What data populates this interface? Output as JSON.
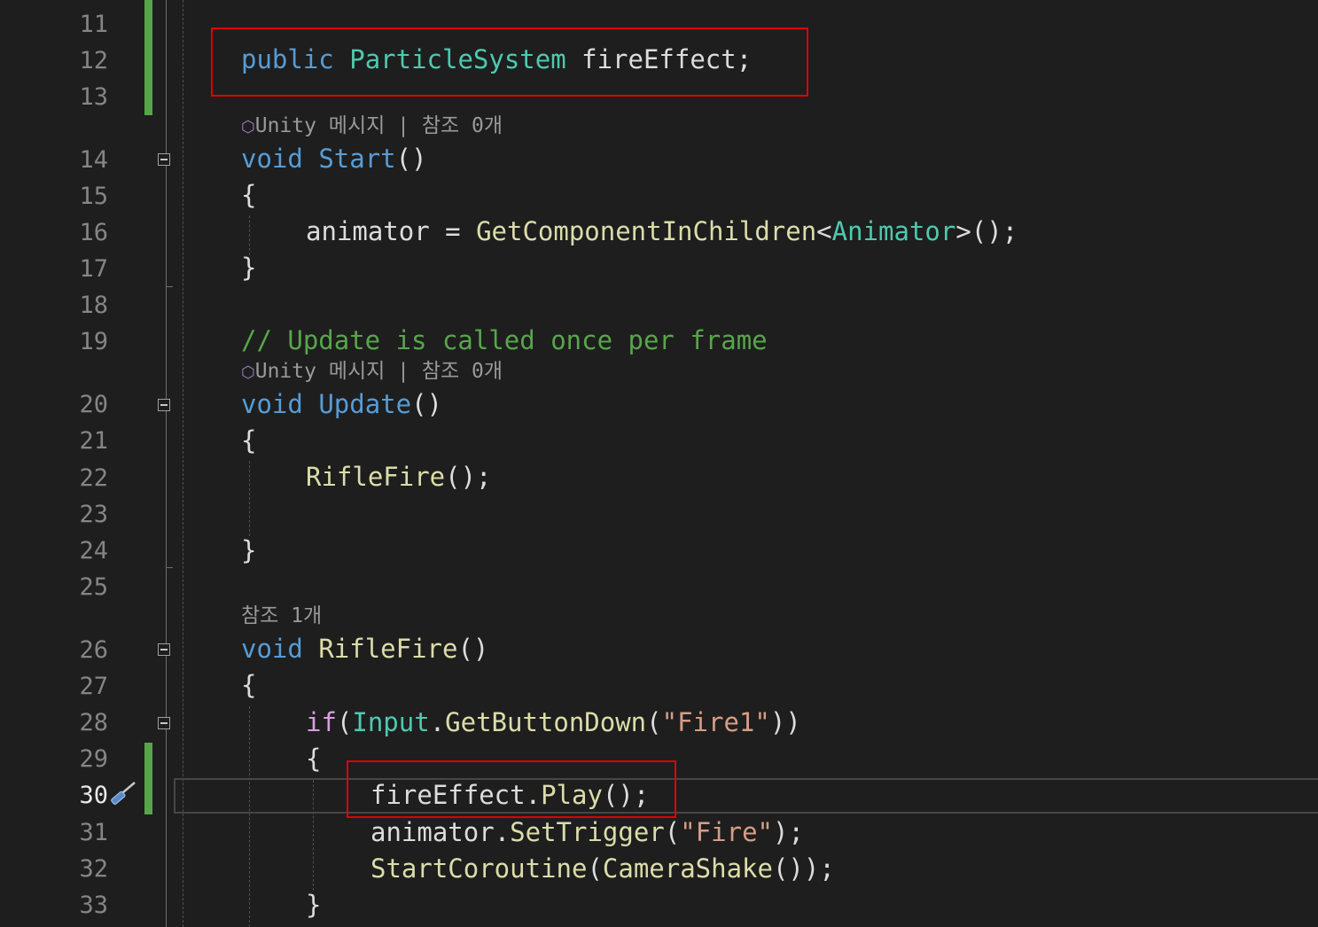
{
  "editor": {
    "line_numbers": [
      "11",
      "12",
      "13",
      "14",
      "15",
      "16",
      "17",
      "18",
      "19",
      "20",
      "21",
      "22",
      "23",
      "24",
      "25",
      "26",
      "27",
      "28",
      "29",
      "30",
      "31",
      "32",
      "33"
    ],
    "current_line": "30",
    "code": {
      "l12": {
        "kw": "public",
        "type": "ParticleSystem",
        "rest": " fireEffect;"
      },
      "l14": {
        "kw": "void",
        "name": "Start",
        "rest": "()"
      },
      "l15": "{",
      "l16": {
        "lhs": "animator = ",
        "method": "GetComponentInChildren",
        "lt": "<",
        "type": "Animator",
        "rest": ">();"
      },
      "l17": "}",
      "l19": "// Update is called once per frame",
      "l20": {
        "kw": "void",
        "name": "Update",
        "rest": "()"
      },
      "l21": "{",
      "l22": {
        "method": "RifleFire",
        "rest": "();"
      },
      "l24": "}",
      "l26": {
        "kw": "void",
        "name": "RifleFire",
        "rest": "()"
      },
      "l27": "{",
      "l28": {
        "kw": "if",
        "p1": "(",
        "type": "Input",
        "dot": ".",
        "method": "GetButtonDown",
        "p2": "(",
        "str": "\"Fire1\"",
        "p3": "))"
      },
      "l29": "{",
      "l30": {
        "obj": "fireEffect",
        "dot": ".",
        "method": "Play",
        "rest": "();"
      },
      "l31": {
        "obj": "animator",
        "dot": ".",
        "method": "SetTrigger",
        "p1": "(",
        "str": "\"Fire\"",
        "rest": ");"
      },
      "l32": {
        "method": "StartCoroutine",
        "p1": "(",
        "method2": "CameraShake",
        "rest": "());"
      },
      "l33": "}"
    },
    "codelens": {
      "start": {
        "text": "Unity 메시지 | 참조 0개"
      },
      "update": {
        "text": "Unity 메시지 | 참조 0개"
      },
      "riflefire": {
        "text": "참조 1개"
      }
    },
    "icons": {
      "unity": "unity-cube-icon",
      "edit": "quick-action-screwdriver-icon"
    },
    "colors": {
      "keyword": "#569cd6",
      "control": "#d8a0df",
      "type": "#4ec9b0",
      "method": "#dcdcaa",
      "string": "#d69d85",
      "comment": "#57a64a",
      "highlight_box": "#e00000",
      "change_bar": "#57a64a"
    }
  }
}
